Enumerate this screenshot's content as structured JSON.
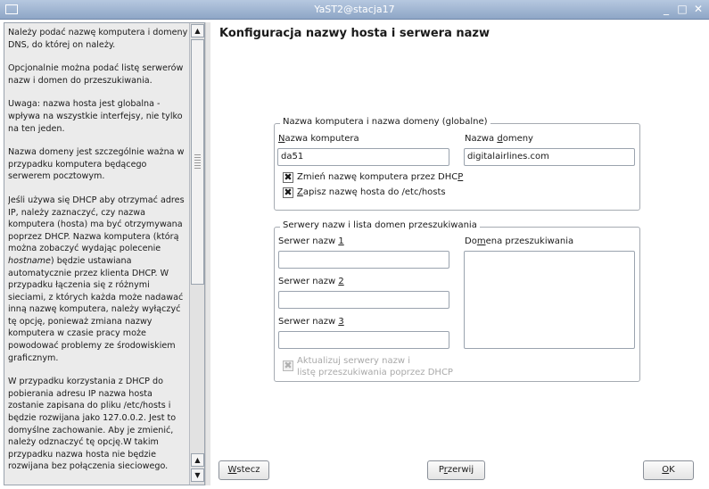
{
  "window": {
    "title": "YaST2@stacja17",
    "min_glyph": "_",
    "max_glyph": "□",
    "close_glyph": "✕"
  },
  "help": {
    "paragraphs": [
      "Należy podać nazwę komputera i domeny DNS, do której on należy.",
      "Opcjonalnie można podać listę serwerów nazw i domen do przeszukiwania.",
      "Uwaga: nazwa hosta jest globalna - wpływa na wszystkie interfejsy, nie tylko na ten jeden.",
      "Nazwa domeny jest szczególnie ważna w przypadku komputera będącego serwerem pocztowym."
    ],
    "dhcp_intro": "Jeśli używa się DHCP aby otrzymać adres IP, należy zaznaczyć, czy nazwa komputera (hosta) ma być otrzymywana poprzez DHCP. Nazwa komputera (którą można zobaczyć wydając polecenie ",
    "dhcp_cmd": "hostname",
    "dhcp_rest": ") będzie ustawiana automatycznie przez klienta DHCP. W przypadku łączenia się z różnymi sieciami, z których każda może nadawać inną nazwę komputera, należy wyłączyć tę opcję, ponieważ zmiana nazwy komputera w czasie pracy może powodować problemy ze środowiskiem graficznym.",
    "last_paragraph": "W przypadku korzystania z DHCP do pobierania adresu IP nazwa hosta zostanie zapisana do pliku /etc/hosts i będzie rozwijana jako 127.0.0.2. Jest to domyślne zachowanie. Aby je zmienić, należy odznaczyć tę opcję.W takim przypadku nazwa hosta nie będzie rozwijana bez połączenia sieciowego.",
    "scroll_up": "▲",
    "scroll_down": "▼"
  },
  "page_title": "Konfiguracja nazwy hosta i serwera nazw",
  "hostname_group": {
    "legend": "Nazwa komputera i nazwa domeny (globalne)",
    "hostname_label_u": "N",
    "hostname_label_rest": "azwa komputera",
    "hostname_value": "da51",
    "domain_label_a": "Nazwa ",
    "domain_label_u": "d",
    "domain_label_b": "omeny",
    "domain_value": "digitalairlines.com",
    "dhcp_check_a": "Zmień nazwę komputera przez DHC",
    "dhcp_check_u": "P",
    "dhcp_checked": true,
    "hosts_check_u": "Z",
    "hosts_check_rest": "apisz nazwę hosta do /etc/hosts",
    "hosts_checked": true,
    "check_glyph": "✖"
  },
  "dns_group": {
    "legend": "Serwery nazw i lista domen przeszukiwania",
    "ns1_label_a": "Serwer nazw ",
    "ns1_label_u": "1",
    "ns2_label_a": "Serwer nazw ",
    "ns2_label_u": "2",
    "ns3_label_a": "Serwer nazw ",
    "ns3_label_u": "3",
    "ns1_value": "",
    "ns2_value": "",
    "ns3_value": "",
    "search_label_a": "Do",
    "search_label_u": "m",
    "search_label_b": "ena przeszukiwania",
    "update_check_line1": "Aktualizuj serwery nazw i",
    "update_check_line2": "listę przeszukiwania poprzez DHCP",
    "update_checked": true,
    "update_enabled": false
  },
  "buttons": {
    "back_u": "W",
    "back_rest": "stecz",
    "abort_a": "P",
    "abort_u": "r",
    "abort_rest": "zerwij",
    "ok_u": "O",
    "ok_rest": "K"
  }
}
